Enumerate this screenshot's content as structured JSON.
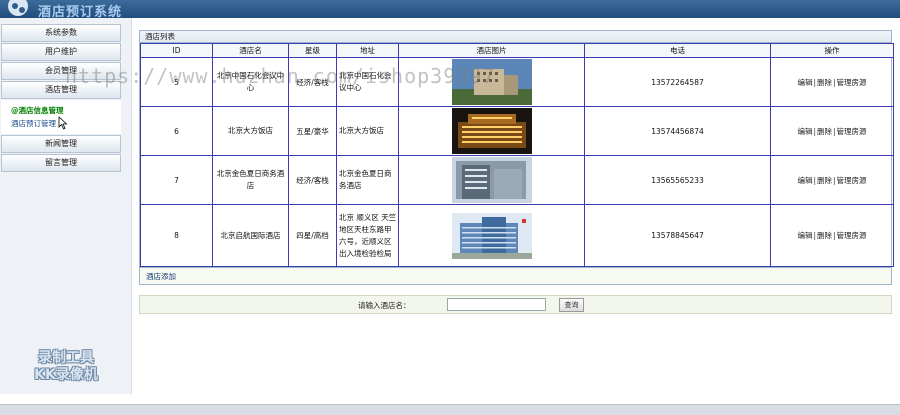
{
  "app": {
    "title": "酒店预订系统"
  },
  "sidebar": {
    "items": [
      {
        "label": "系统参数"
      },
      {
        "label": "用户维护"
      },
      {
        "label": "会员管理"
      },
      {
        "label": "酒店管理"
      }
    ],
    "submenu": [
      {
        "label": "@酒店信息管理"
      },
      {
        "label": "酒店预订管理"
      }
    ],
    "items_after": [
      {
        "label": "新闻管理"
      },
      {
        "label": "留言管理"
      }
    ],
    "recorder_watermark": [
      "录制工具",
      "KK录像机"
    ]
  },
  "panel": {
    "title": "酒店列表"
  },
  "table": {
    "headers": [
      "ID",
      "酒店名",
      "星级",
      "地址",
      "酒店图片",
      "电话",
      "操作"
    ],
    "rows": [
      {
        "id": "5",
        "name": "北京中国石化会议中心",
        "star": "经济/客栈",
        "address": "北京中国石化会议中心",
        "phone": "13572264587"
      },
      {
        "id": "6",
        "name": "北京大方饭店",
        "star": "五星/豪华",
        "address": "北京大方饭店",
        "phone": "13574456874"
      },
      {
        "id": "7",
        "name": "北京金色夏日商务酒店",
        "star": "经济/客栈",
        "address": "北京金色夏日商务酒店",
        "phone": "13565565233"
      },
      {
        "id": "8",
        "name": "北京启航国际酒店",
        "star": "四星/高档",
        "address": "北京 顺义区 天竺地区天柱东路甲六号，近顺义区出入境检验检局",
        "phone": "13578845647"
      }
    ],
    "ops": {
      "edit": "编辑",
      "delete": "删除",
      "rooms": "管理房源",
      "sep": "|"
    }
  },
  "add_link": "酒店添加",
  "search": {
    "label": "请输入酒店名：",
    "value": "",
    "button": "查询"
  },
  "url_watermark": "https://www.huzhan.com/ishop39397",
  "colors": {
    "topbar": "#2e5d8e",
    "table_border": "#3b3bb0",
    "active_submenu": "#008000"
  }
}
